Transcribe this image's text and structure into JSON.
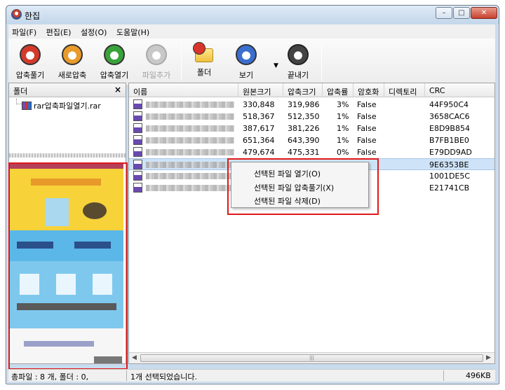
{
  "window": {
    "title": "한집"
  },
  "menu": [
    "파일(F)",
    "편집(E)",
    "설정(O)",
    "도움말(H)"
  ],
  "toolbar": {
    "extract": "압축풀기",
    "new_archive": "새로압축",
    "open_archive": "압축열기",
    "add_file": "파일추가",
    "folder": "폴더",
    "view": "보기",
    "exit": "끝내기"
  },
  "left_panel": {
    "header": "폴더",
    "close_glyph": "×",
    "tree_item": "rar압축파일열기.rar"
  },
  "columns": {
    "name": "이름",
    "original_size": "원본크기",
    "compressed_size": "압축크기",
    "ratio": "압축률",
    "encrypted": "암호화",
    "directory": "디렉토리",
    "crc": "CRC"
  },
  "files": [
    {
      "orig": "330,848",
      "comp": "319,986",
      "ratio": "3%",
      "enc": "False",
      "crc": "44F950C4"
    },
    {
      "orig": "518,367",
      "comp": "512,350",
      "ratio": "1%",
      "enc": "False",
      "crc": "3658CAC6"
    },
    {
      "orig": "387,617",
      "comp": "381,226",
      "ratio": "1%",
      "enc": "False",
      "crc": "E8D9B854"
    },
    {
      "orig": "651,364",
      "comp": "643,390",
      "ratio": "1%",
      "enc": "False",
      "crc": "B7FB1BE0"
    },
    {
      "orig": "479,674",
      "comp": "475,331",
      "ratio": "0%",
      "enc": "False",
      "crc": "E79DD9AD"
    },
    {
      "orig": "",
      "comp": "",
      "ratio": "",
      "enc": "",
      "crc": "9E6353BE"
    },
    {
      "orig": "",
      "comp": "",
      "ratio": "",
      "enc": "",
      "crc": "1001DE5C"
    },
    {
      "orig": "",
      "comp": "",
      "ratio": "",
      "enc": "",
      "crc": "E21741CB"
    }
  ],
  "context_menu": {
    "open": "선택된 파일 열기(O)",
    "extract": "선택된 파일 압축풀기(X)",
    "delete": "선택된 파일 삭제(D)"
  },
  "status": {
    "totals": "총파일 : 8 개, 폴더 : 0,",
    "selection": "1개 선택되었습니다.",
    "size": "496KB"
  },
  "colors": {
    "highlight_red": "#e11818",
    "selection_blue": "#cfe3f8"
  }
}
